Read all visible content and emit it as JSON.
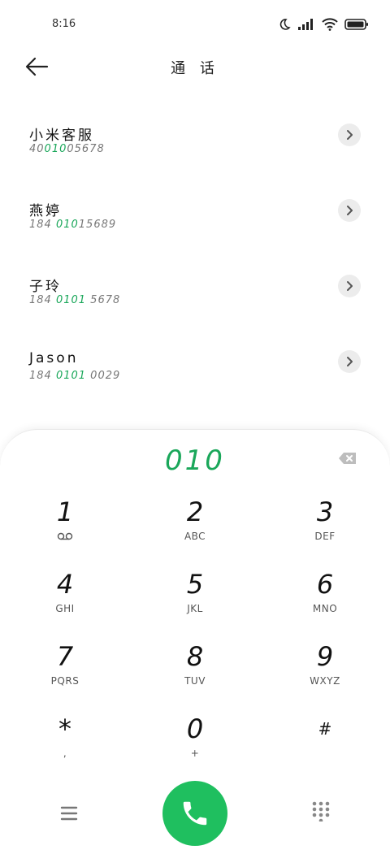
{
  "status": {
    "time": "8:16"
  },
  "header": {
    "title": "通 话"
  },
  "contacts": [
    {
      "name": "小米客服",
      "number_pre": "40",
      "number_match": "010",
      "number_post": "05678"
    },
    {
      "name": "燕婷",
      "number_pre": "184 ",
      "number_match": "010",
      "number_post": "15689"
    },
    {
      "name": "子玲",
      "number_pre": "184 ",
      "number_match": "0101",
      "number_post": " 5678"
    },
    {
      "name": "Jason",
      "number_pre": "184 ",
      "number_match": "0101",
      "number_post": " 0029"
    }
  ],
  "dialpad": {
    "input": "010",
    "keys": [
      {
        "digit": "1",
        "letters": "",
        "icon": "voicemail-icon"
      },
      {
        "digit": "2",
        "letters": "ABC"
      },
      {
        "digit": "3",
        "letters": "DEF"
      },
      {
        "digit": "4",
        "letters": "GHI"
      },
      {
        "digit": "5",
        "letters": "JKL"
      },
      {
        "digit": "6",
        "letters": "MNO"
      },
      {
        "digit": "7",
        "letters": "PQRS"
      },
      {
        "digit": "8",
        "letters": "TUV"
      },
      {
        "digit": "9",
        "letters": "WXYZ"
      },
      {
        "digit": "*",
        "letters": ","
      },
      {
        "digit": "0",
        "letters": "+"
      },
      {
        "digit": "#",
        "letters": ""
      }
    ]
  },
  "colors": {
    "accent": "#1aa75a",
    "call_button": "#1fbf5f"
  }
}
